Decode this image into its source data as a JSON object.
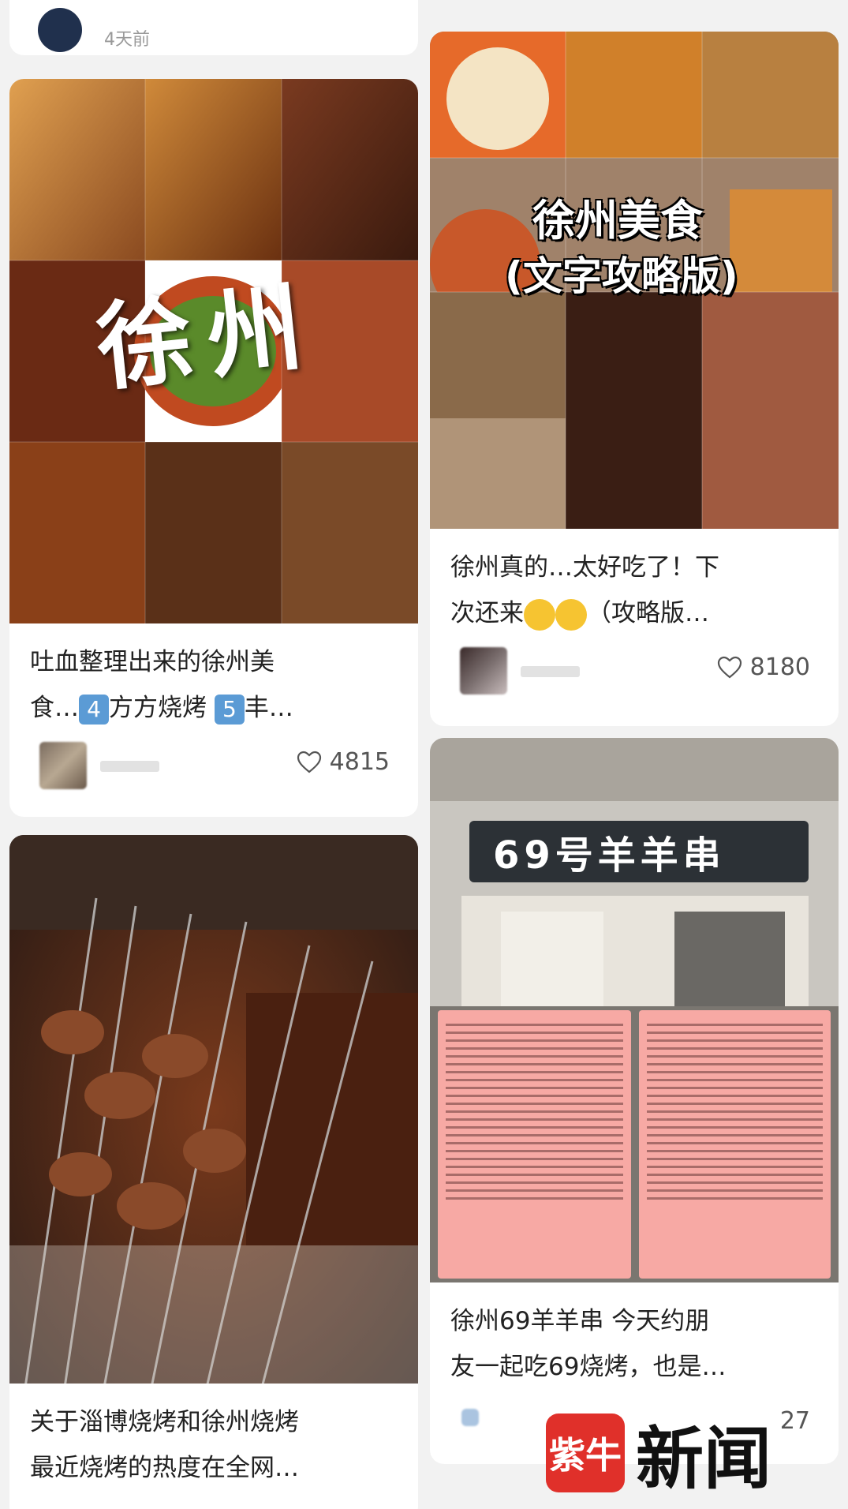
{
  "top_card": {
    "time": "4天前"
  },
  "cards": {
    "xuzhou_food": {
      "overlay": "徐州",
      "title_line1": "吐血整理出来的徐州美",
      "title_line2_pre": "食…",
      "kw4": "4",
      "title_line2_mid": "方方烧烤",
      "kw5": "5",
      "title_line2_post": "丰…",
      "likes": "4815"
    },
    "guide": {
      "overlay_title": "徐州美食",
      "overlay_sub": "(文字攻略版)",
      "title_line1": "徐州真的…太好吃了！下",
      "title_line2_pre": "次还来",
      "title_line2_post": "（攻略版…",
      "likes": "8180"
    },
    "skewer": {
      "title_line1": "关于淄博烧烤和徐州烧烤",
      "title_line2": "最近烧烤的热度在全网…"
    },
    "lamb69": {
      "sign": "69号羊羊串",
      "title_line1": "徐州69羊羊串 今天约朋",
      "title_line2": "友一起吃69烧烤，也是…",
      "likes": "27"
    }
  },
  "watermark": {
    "logo": "紫牛",
    "text": "新闻"
  },
  "colors": {
    "card": "#ffffff",
    "background": "#f2f2f2",
    "brand_red": "#e0302a"
  }
}
